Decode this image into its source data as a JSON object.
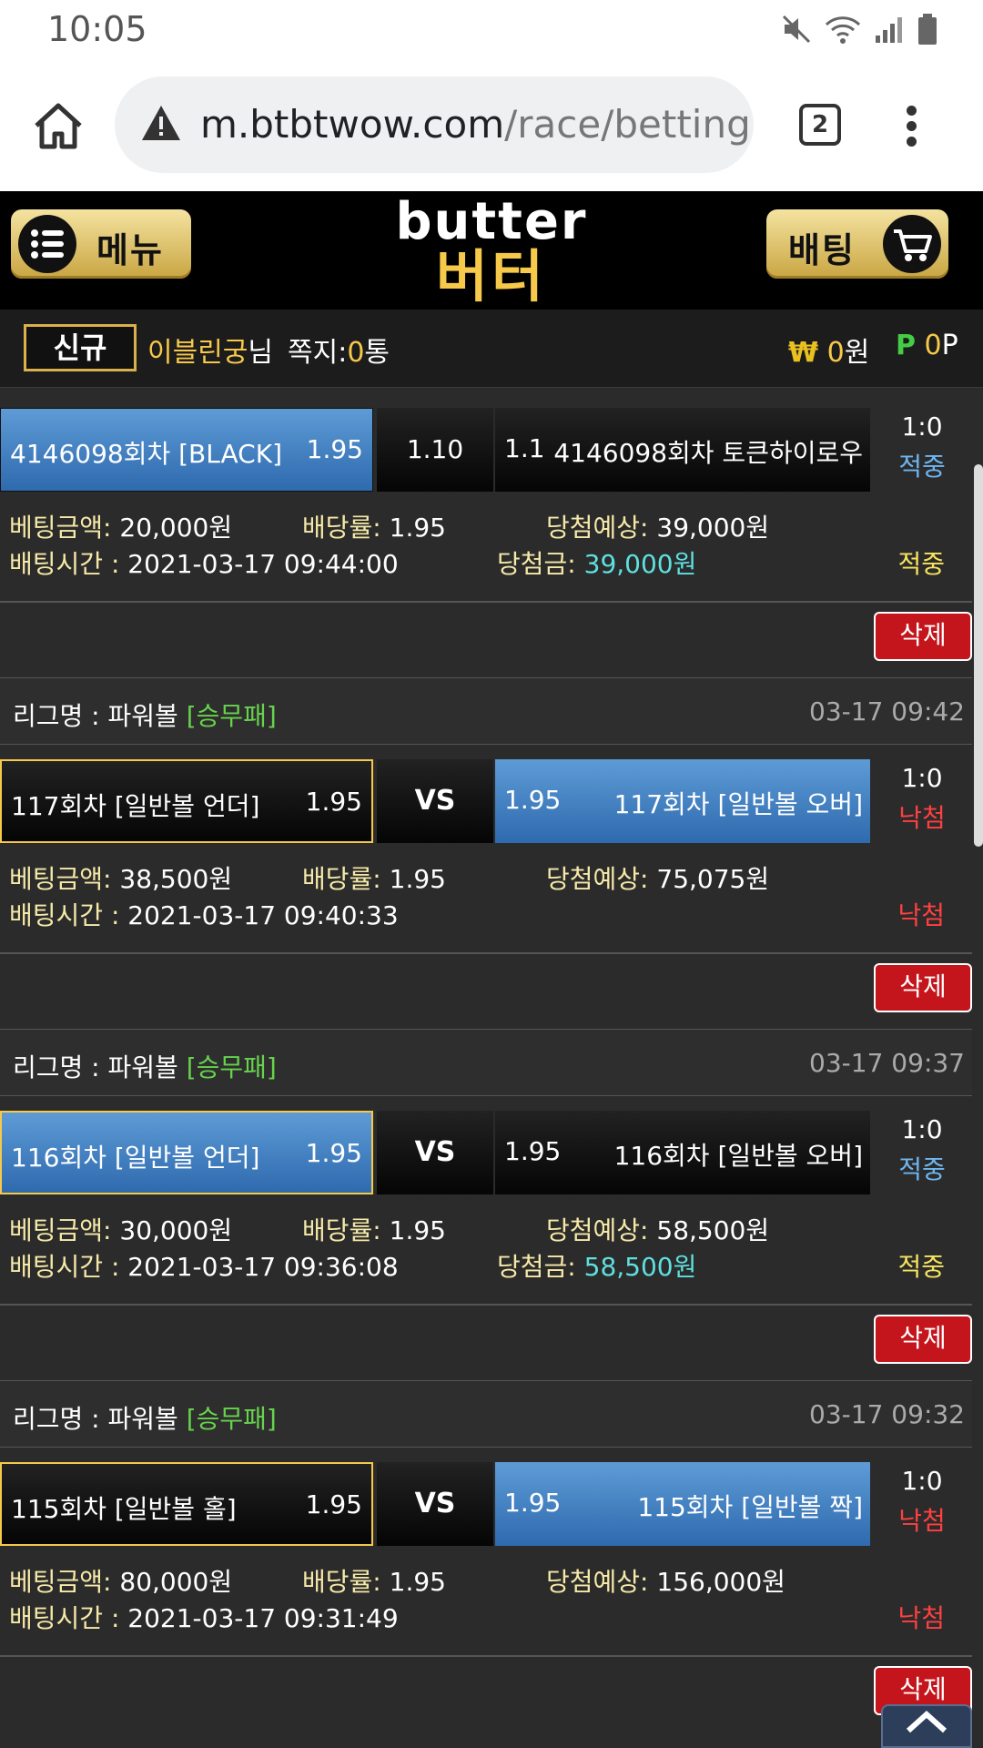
{
  "status_bar": {
    "time": "10:05"
  },
  "browser": {
    "url_host": "m.btbtwow.com",
    "url_path": "/race/betting",
    "tab_count": "2"
  },
  "header": {
    "menu_label": "메뉴",
    "logo_en": "butter",
    "logo_ko": "버터",
    "bet_label": "배팅"
  },
  "user": {
    "badge": "신규",
    "name": "이블린궁",
    "suffix": "님",
    "msg_label": "쪽지:",
    "msg_count": "0",
    "msg_unit": "통",
    "money_symbol": "₩",
    "money": "0",
    "money_unit": "원",
    "point_symbol": "P",
    "points": "0",
    "point_unit": "P"
  },
  "labels": {
    "bet_amount": "베팅금액:",
    "odds": "배당률:",
    "expected": "당첨예상:",
    "bet_time": "배팅시간 :",
    "win_amount": "당첨금:",
    "delete": "삭제",
    "league_prefix": "리그명 : ",
    "vs": "VS"
  },
  "bets": [
    {
      "league": null,
      "league_type": null,
      "date": null,
      "home": "4146098회차 [BLACK]",
      "home_odds": "1.95",
      "middle": "1.10",
      "away_odds": "1.1",
      "away": "4146098회차 토큰하이로우",
      "score": "1:0",
      "result": "적중",
      "bet_amount": "20,000원",
      "odds": "1.95",
      "expected": "39,000원",
      "bet_time": "2021-03-17 09:44:00",
      "win_amount": "39,000원",
      "status": "적중"
    },
    {
      "league": "파워볼",
      "league_type": "[승무패]",
      "date": "03-17 09:42",
      "home": "117회차 [일반볼 언더]",
      "home_odds": "1.95",
      "middle": "VS",
      "away_odds": "1.95",
      "away": "117회차 [일반볼 오버]",
      "score": "1:0",
      "result": "낙첨",
      "bet_amount": "38,500원",
      "odds": "1.95",
      "expected": "75,075원",
      "bet_time": "2021-03-17 09:40:33",
      "win_amount": null,
      "status": "낙첨"
    },
    {
      "league": "파워볼",
      "league_type": "[승무패]",
      "date": "03-17 09:37",
      "home": "116회차 [일반볼 언더]",
      "home_odds": "1.95",
      "middle": "VS",
      "away_odds": "1.95",
      "away": "116회차 [일반볼 오버]",
      "score": "1:0",
      "result": "적중",
      "bet_amount": "30,000원",
      "odds": "1.95",
      "expected": "58,500원",
      "bet_time": "2021-03-17 09:36:08",
      "win_amount": "58,500원",
      "status": "적중"
    },
    {
      "league": "파워볼",
      "league_type": "[승무패]",
      "date": "03-17 09:32",
      "home": "115회차 [일반볼 홀]",
      "home_odds": "1.95",
      "middle": "VS",
      "away_odds": "1.95",
      "away": "115회차 [일반볼 짝]",
      "score": "1:0",
      "result": "낙첨",
      "bet_amount": "80,000원",
      "odds": "1.95",
      "expected": "156,000원",
      "bet_time": "2021-03-17 09:31:49",
      "win_amount": null,
      "status": "낙첨"
    }
  ],
  "scroll_top_label": "TOP",
  "colors": {
    "gold": "#f6c94a",
    "selected_blue": "#3f7fc2",
    "win_blue": "#6fb6f0",
    "lose_red": "#ff4040",
    "delete_red": "#c4151c",
    "league_green": "#67d24d"
  }
}
